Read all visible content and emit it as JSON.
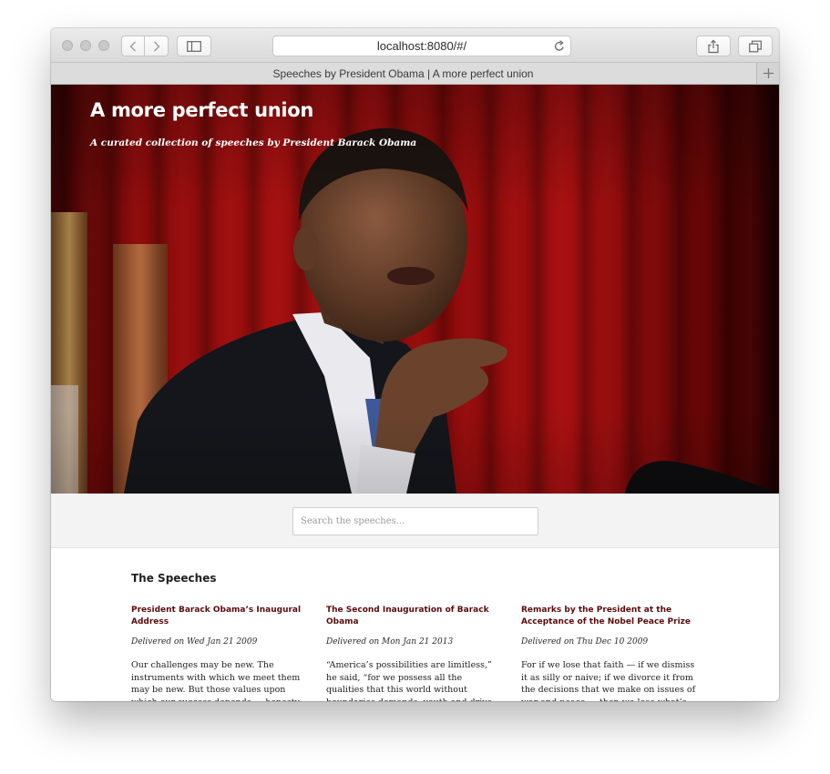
{
  "browser": {
    "url": "localhost:8080/#/",
    "tab_title": "Speeches by President Obama | A more perfect union"
  },
  "hero": {
    "title": "A more perfect union",
    "subtitle": "A curated collection of speeches by President Barack Obama",
    "image_alt": "President Barack Obama speaking at a podium in front of red curtains"
  },
  "search": {
    "placeholder": "Search the speeches..."
  },
  "speeches": {
    "heading": "The Speeches",
    "items": [
      {
        "title": "President Barack Obama’s Inaugural Address",
        "date": "Delivered on Wed Jan 21 2009",
        "excerpt": "Our challenges may be new. The instruments with which we meet them may be new. But those values upon which our success depends — honesty and hard"
      },
      {
        "title": "The Second Inauguration of Barack Obama",
        "date": "Delivered on Mon Jan 21 2013",
        "excerpt": "“America’s possibilities are limitless,” he said, “for we possess all the qualities that this world without boundaries demands: youth and drive; diversity and openness;"
      },
      {
        "title": "Remarks by the President at the Acceptance of the Nobel Peace Prize",
        "date": "Delivered on Thu Dec 10 2009",
        "excerpt": "For if we lose that faith — if we dismiss it as silly or naive; if we divorce it from the decisions that we make on issues of war and peace — then we lose what’s best"
      }
    ]
  },
  "colors": {
    "accent": "#5a0b0b",
    "hero_red": "#a10f0f"
  }
}
